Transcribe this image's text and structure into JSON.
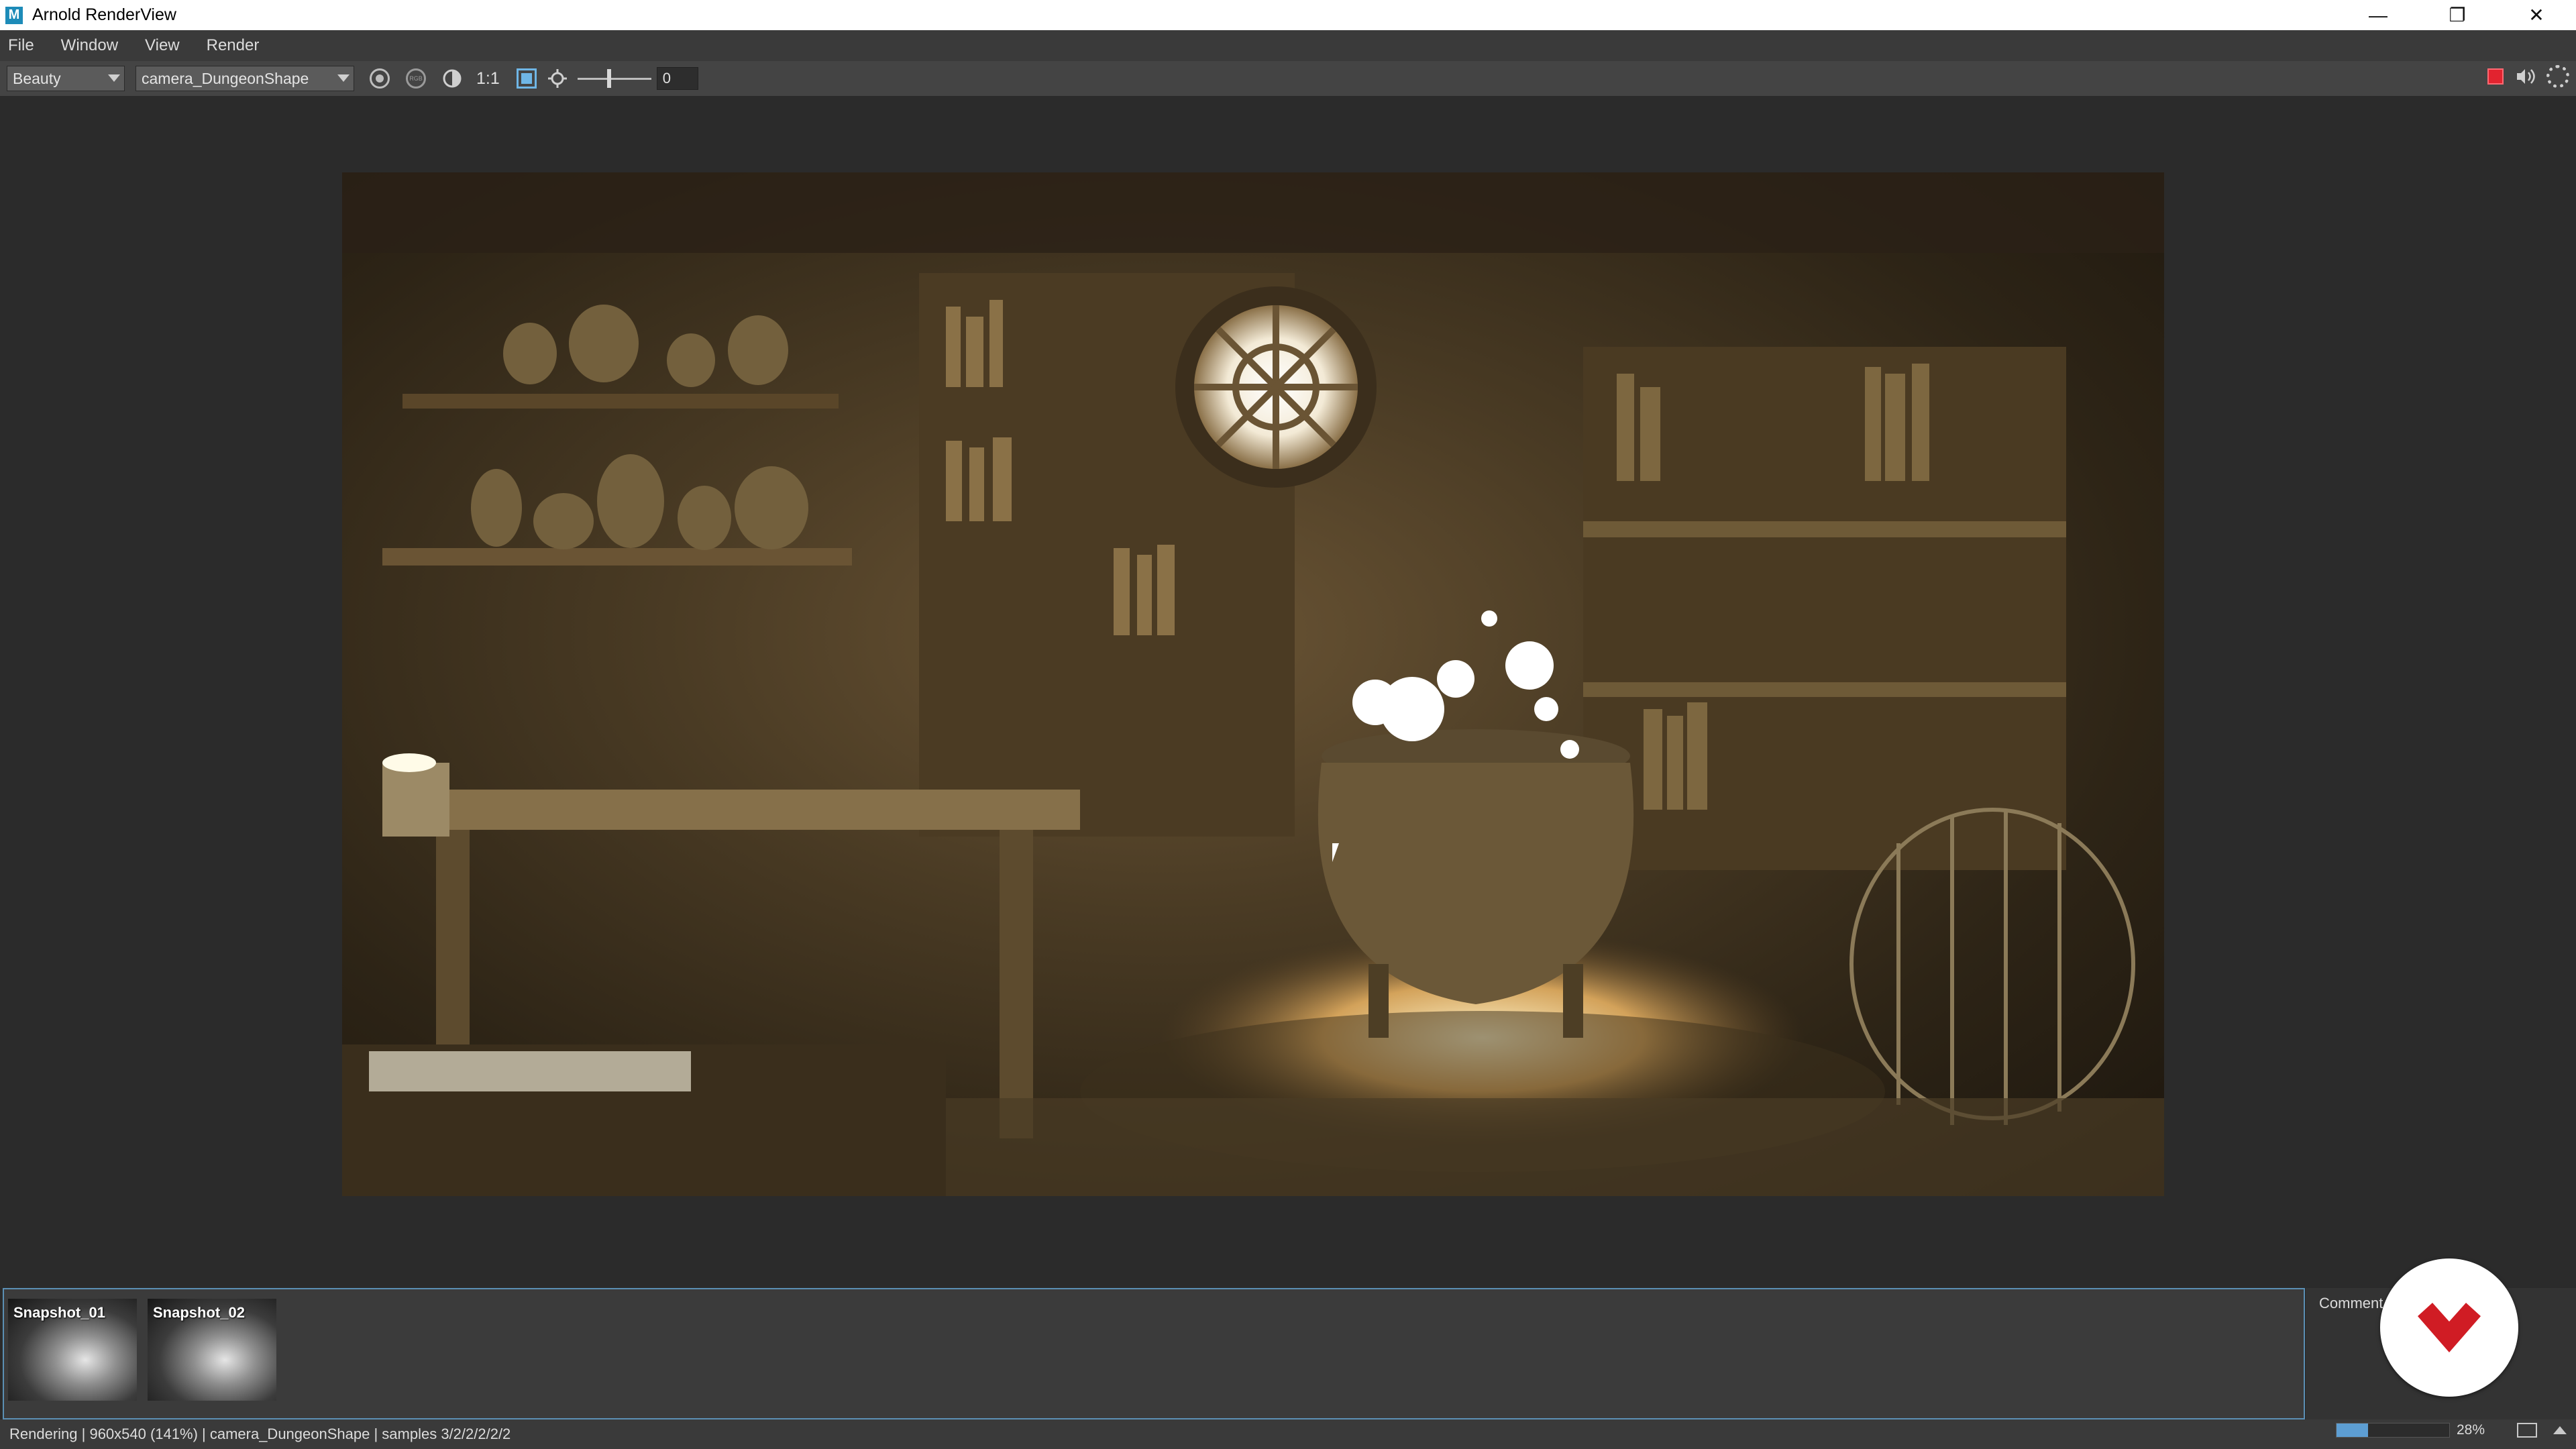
{
  "window": {
    "title": "Arnold RenderView",
    "app_icon": "M",
    "controls": [
      "minimize-icon",
      "restore-icon",
      "close-icon"
    ],
    "minimize_glyph": "—",
    "restore_glyph": "❐",
    "close_glyph": "✕"
  },
  "menubar": {
    "items": [
      "File",
      "Window",
      "View",
      "Render"
    ]
  },
  "toolbar": {
    "aov": "Beauty",
    "camera": "camera_DungeonShape",
    "ratio_label": "1:1",
    "rgb_label": "RGB",
    "exposure_value": "0",
    "stop_color": "#e2232f"
  },
  "render": {
    "scene": "dungeon-alchemy-room"
  },
  "snapshots": [
    {
      "label": "Snapshot_01"
    },
    {
      "label": "Snapshot_02"
    }
  ],
  "comments": {
    "label": "Comment"
  },
  "status": {
    "text": "Rendering | 960x540 (141%) | camera_DungeonShape  | samples 3/2/2/2/2/2",
    "progress_percent": 28,
    "progress_label": "28%"
  },
  "colors": {
    "accent": "#5d9ed3",
    "logo_red": "#d01c24"
  }
}
